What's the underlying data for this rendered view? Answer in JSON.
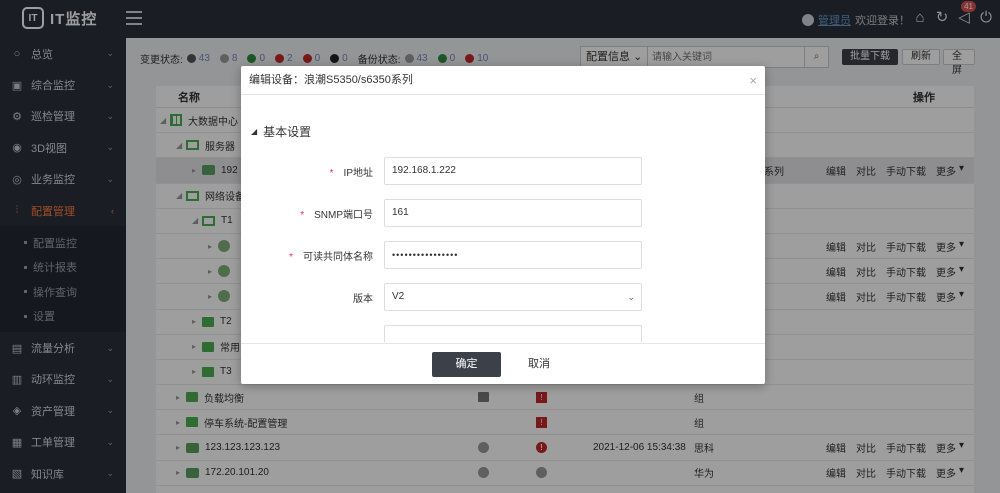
{
  "app": {
    "logo_mark": "IT",
    "logo_text": "IT监控"
  },
  "header": {
    "user_name": "管理员",
    "welcome": "欢迎登录！",
    "notif_count": "41",
    "icons": [
      "home-icon",
      "refresh-icon",
      "bell-icon",
      "power-icon"
    ]
  },
  "sidebar": {
    "items": [
      {
        "label": "总览",
        "icon": "○"
      },
      {
        "label": "综合监控",
        "icon": "▣"
      },
      {
        "label": "巡检管理",
        "icon": "⚙"
      },
      {
        "label": "3D视图",
        "icon": "◉"
      },
      {
        "label": "业务监控",
        "icon": "◎"
      },
      {
        "label": "配置管理",
        "icon": "⫶"
      },
      {
        "label": "流量分析",
        "icon": "▤"
      },
      {
        "label": "动环监控",
        "icon": "▥"
      },
      {
        "label": "资产管理",
        "icon": "◈"
      },
      {
        "label": "工单管理",
        "icon": "▦"
      },
      {
        "label": "知识库",
        "icon": "▧"
      }
    ],
    "sub_items": [
      "配置监控",
      "统计报表",
      "操作查询",
      "设置"
    ]
  },
  "toolbar": {
    "change_status_label": "变更状态:",
    "backup_status_label": "备份状态:",
    "change_stats": [
      {
        "color": "#555555",
        "num": "43"
      },
      {
        "color": "#999999",
        "num": "8"
      },
      {
        "color": "#2e8b3e",
        "num": "0"
      },
      {
        "color": "#c0272d",
        "num": "2"
      },
      {
        "color": "#c0272d",
        "num": "0"
      },
      {
        "color": "#222222",
        "num": "0"
      }
    ],
    "backup_stats": [
      {
        "color": "#999999",
        "num": "43"
      },
      {
        "color": "#2e8b3e",
        "num": "0"
      },
      {
        "color": "#c0272d",
        "num": "10"
      }
    ],
    "search_select": "配置信息",
    "search_placeholder": "请输入关键词",
    "batch_download": "批量下载",
    "refresh": "刷新",
    "fullscreen": "全屏"
  },
  "table": {
    "col_name": "名称",
    "col_ops": "操作",
    "rows": [
      {
        "name": "大数据中心"
      },
      {
        "name": "服务器"
      },
      {
        "name": "192",
        "type": "系列",
        "ops": [
          "编辑",
          "对比",
          "手动下载",
          "更多"
        ]
      },
      {
        "name": "网络设备"
      },
      {
        "name": "T1"
      },
      {
        "name": "",
        "ops": [
          "编辑",
          "对比",
          "手动下载",
          "更多"
        ]
      },
      {
        "name": "",
        "ops": [
          "编辑",
          "对比",
          "手动下载",
          "更多"
        ]
      },
      {
        "name": "",
        "ops": [
          "编辑",
          "对比",
          "手动下载",
          "更多"
        ]
      },
      {
        "name": "T2"
      },
      {
        "name": "常用"
      },
      {
        "name": "T3"
      },
      {
        "name": "负载均衡",
        "type": "组"
      },
      {
        "name": "停车系统-配置管理",
        "type": "组"
      },
      {
        "name": "123.123.123.123",
        "time": "2021-12-06 15:34:38",
        "type": "思科",
        "ops": [
          "编辑",
          "对比",
          "手动下载",
          "更多"
        ]
      },
      {
        "name": "172.20.101.20",
        "type": "华为",
        "ops": [
          "编辑",
          "对比",
          "手动下载",
          "更多"
        ]
      }
    ]
  },
  "modal": {
    "title": "编辑设备：浪潮S5350/s6350系列",
    "section": "基本设置",
    "fields": {
      "ip_label": "IP地址",
      "ip_value": "192.168.1.222",
      "snmp_label": "SNMP端口号",
      "snmp_value": "161",
      "community_label": "可读共同体名称",
      "community_value": "••••••••••••••••",
      "version_label": "版本",
      "version_value": "V2"
    },
    "ok": "确定",
    "cancel": "取消"
  }
}
